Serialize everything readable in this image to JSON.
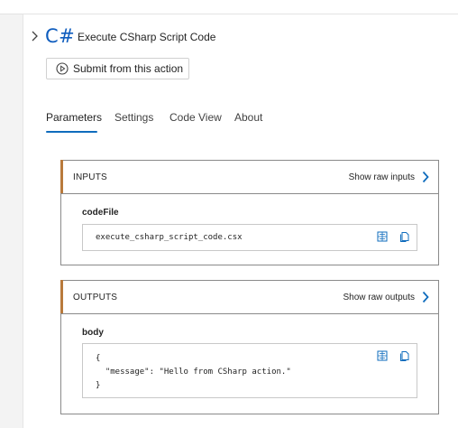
{
  "header": {
    "expand_icon": "chevron-right-icon",
    "app_icon_text": "C#",
    "title": "Execute CSharp Script Code",
    "submit_button": {
      "label": "Submit from this action",
      "icon": "play-circle-icon"
    }
  },
  "tabs": [
    {
      "label": "Parameters",
      "active": true
    },
    {
      "label": "Settings",
      "active": false
    },
    {
      "label": "Code View",
      "active": false
    },
    {
      "label": "About",
      "active": false
    }
  ],
  "inputs": {
    "title": "INPUTS",
    "raw_link": "Show raw inputs",
    "field_label": "codeFile",
    "value": "execute_csharp_script_code.csx"
  },
  "outputs": {
    "title": "OUTPUTS",
    "raw_link": "Show raw outputs",
    "field_label": "body",
    "value_lines": [
      "{",
      "  \"message\": \"Hello from CSharp action.\"",
      "}"
    ]
  },
  "colors": {
    "accent_blue": "#0f6cbd",
    "section_accent": "#b97a3c",
    "csharp_blue": "#0f5dbe"
  },
  "icons": {
    "expand_view": "grid-expand-icon",
    "copy": "copy-icon",
    "chevron": "chevron-right-icon"
  }
}
